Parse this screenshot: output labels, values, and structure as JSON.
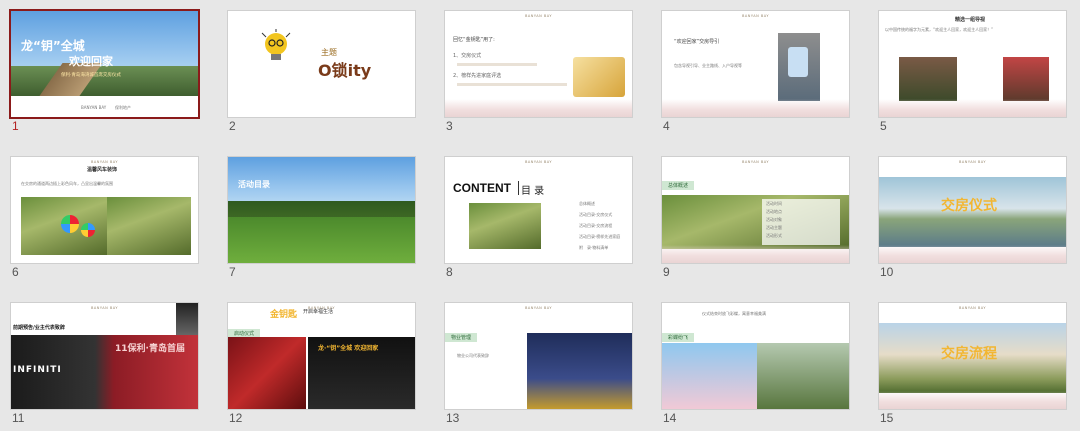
{
  "colors": {
    "selected_border": "#8b1a1a",
    "panel_bg": "#e7e7e7",
    "accent_green": "#cfe7d2",
    "accent_gold": "#f2b632"
  },
  "brand_small": "BANYAN BAY",
  "slides": [
    {
      "number": "1",
      "selected": true,
      "title_line1": "龙“钥”全城",
      "title_line2": "欢迎回家",
      "subtitle": "保利·青岛海湾城首席交房仪式",
      "footer_logo": "BANYAN BAY",
      "footer_brand": "保利地产"
    },
    {
      "number": "2",
      "label": "主题",
      "big": "O锁ity",
      "icon": "lightbulb-key-icon"
    },
    {
      "number": "3",
      "heading": "回忆“金钥匙”用了:",
      "items": [
        "1、交房仪式",
        "2、榜样先进家庭评选"
      ],
      "icon": "golden-key-icon"
    },
    {
      "number": "4",
      "heading": "“欢迎回家”交房导引",
      "body": "包含导视引导、业主路线、入户导视等"
    },
    {
      "number": "5",
      "heading": "精选一组导视",
      "body": "以中国传统的福字为元素，“欢迎主人回家，欢迎主人回家！”"
    },
    {
      "number": "6",
      "heading": "温馨风车装饰",
      "body": "在交房的通道两边插上彩色风车，凸显出温馨的氛围"
    },
    {
      "number": "7",
      "tag": "活动目录"
    },
    {
      "number": "8",
      "title": "CONTENT",
      "title_cn": "目 录",
      "items": [
        "总体概述",
        "活动目录·交房仪式",
        "活动目录·交房流程",
        "活动目录·榜样先进家庭",
        "附　录·物料清单"
      ]
    },
    {
      "number": "9",
      "tag": "总体概述",
      "lines": [
        "活动时间",
        "活动地点",
        "活动对象",
        "活动主题",
        "活动形式"
      ]
    },
    {
      "number": "10",
      "title": "交房仪式"
    },
    {
      "number": "11",
      "heading": "前期预告/业主代表致辞",
      "banner": "11保利·青岛首届",
      "brand": "INFINITI"
    },
    {
      "number": "12",
      "heading": "金钥匙",
      "subheading": "开启幸福生活",
      "tag": "启动仪式",
      "panel_text": "龙·“钥”全城 欢迎回家"
    },
    {
      "number": "13",
      "tag": "物业管理",
      "body": "物业公司代表致辞"
    },
    {
      "number": "14",
      "tag": "彩蝶纷飞",
      "body": "仪式结束时放飞彩蝶，寓意幸福美满"
    },
    {
      "number": "15",
      "title": "交房流程"
    }
  ]
}
